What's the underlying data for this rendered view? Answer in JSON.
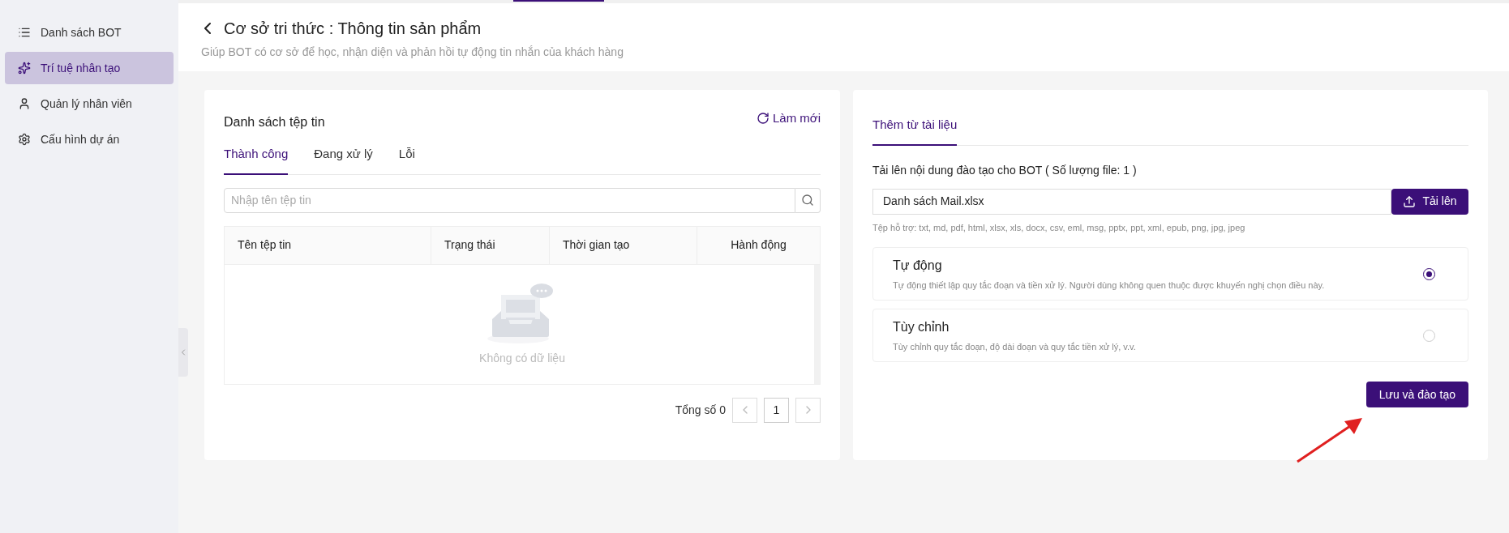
{
  "sidebar": {
    "items": [
      {
        "label": "Danh sách BOT",
        "selected": false
      },
      {
        "label": "Trí tuệ nhân tạo",
        "selected": true
      },
      {
        "label": "Quản lý nhân viên",
        "selected": false
      },
      {
        "label": "Cấu hình dự án",
        "selected": false
      }
    ]
  },
  "header": {
    "title": "Cơ sở tri thức : Thông tin sản phẩm",
    "subtitle": "Giúp BOT có cơ sở để học, nhận diện và phản hồi tự động tin nhắn của khách hàng"
  },
  "file_list": {
    "title": "Danh sách tệp tin",
    "refresh": "Làm mới",
    "tabs": [
      {
        "label": "Thành công",
        "selected": true
      },
      {
        "label": "Đang xử lý",
        "selected": false
      },
      {
        "label": "Lỗi",
        "selected": false
      }
    ],
    "search": {
      "placeholder": "Nhập tên tệp tin"
    },
    "table": {
      "columns": [
        "Tên tệp tin",
        "Trạng thái",
        "Thời gian tạo",
        "Hành động"
      ],
      "empty_text": "Không có dữ liệu"
    },
    "pagination": {
      "total": "Tổng số 0",
      "pages": [
        {
          "label": "1",
          "selected": true
        }
      ]
    }
  },
  "upload": {
    "tabs": [
      {
        "label": "Thêm từ tài liệu",
        "selected": true
      }
    ],
    "label": "Tải lên nội dung đào tạo cho BOT ( Số lượng file: 1 )",
    "file_name": "Danh sách Mail.xlsx",
    "upload_button": "Tải lên",
    "hint": "Tệp hỗ trợ: txt, md, pdf, html, xlsx, xls, docx, csv, eml, msg, pptx, ppt, xml, epub, png, jpg, jpeg",
    "options": [
      {
        "title": "Tự động",
        "description": "Tự động thiết lập quy tắc đoạn và tiền xử lý. Người dùng không quen thuộc được khuyến nghị chọn điều này.",
        "selected": true
      },
      {
        "title": "Tùy chỉnh",
        "description": "Tùy chỉnh quy tắc đoạn, độ dài đoạn và quy tắc tiền xử lý, v.v.",
        "selected": false
      }
    ],
    "save_button": "Lưu và đào tạo"
  }
}
